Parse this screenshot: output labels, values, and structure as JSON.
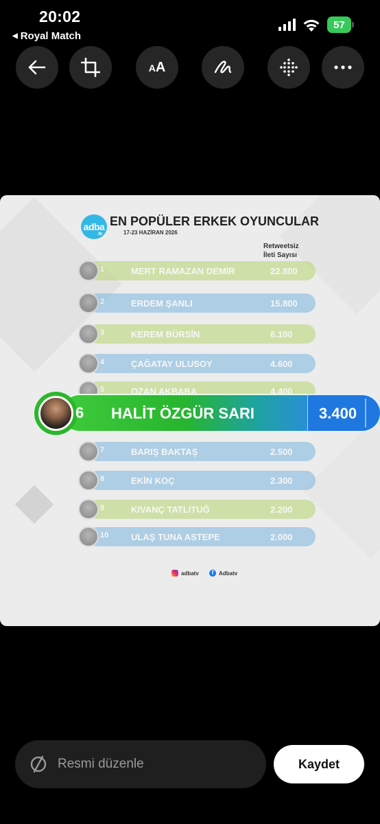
{
  "status_bar": {
    "time": "20:02",
    "back_app_label": "Royal Match",
    "battery_level": "57",
    "icons": [
      "signal-icon",
      "wifi-icon",
      "battery-icon"
    ]
  },
  "toolbar": {
    "buttons": [
      {
        "name": "back-button",
        "icon": "arrow-left-icon"
      },
      {
        "name": "crop-button",
        "icon": "crop-icon"
      },
      {
        "name": "text-button",
        "icon": "text-size-icon",
        "label": "AA"
      },
      {
        "name": "draw-button",
        "icon": "scribble-icon"
      },
      {
        "name": "mosaic-button",
        "icon": "dot-grid-icon"
      },
      {
        "name": "more-button",
        "icon": "ellipsis-icon"
      }
    ]
  },
  "photo": {
    "logo_text": "adba",
    "logo_sub": ".tv",
    "title": "EN POPÜLER ERKEK OYUNCULAR",
    "date": "17-23 HAZİRAN 2026",
    "column_header_line1": "Retweetsiz",
    "column_header_line2": "İleti Sayısı",
    "rows": [
      {
        "rank": "1",
        "name": "MERT RAMAZAN DEMİR",
        "value": "22.800",
        "color": "#b7d870"
      },
      {
        "rank": "2",
        "name": "ERDEM ŞANLI",
        "value": "15.800",
        "color": "#7bb7e0"
      },
      {
        "rank": "3",
        "name": "KEREM BÜRSİN",
        "value": "6.100",
        "color": "#b7d870"
      },
      {
        "rank": "4",
        "name": "ÇAĞATAY ULUSOY",
        "value": "4.600",
        "color": "#7bb7e0"
      },
      {
        "rank": "5",
        "name": "OZAN AKBABA",
        "value": "4.400",
        "color": "#b7d870"
      },
      {
        "rank": "7",
        "name": "BARIŞ BAKTAŞ",
        "value": "2.500",
        "color": "#7bb7e0"
      },
      {
        "rank": "8",
        "name": "EKİN KOÇ",
        "value": "2.300",
        "color": "#7bb7e0"
      },
      {
        "rank": "9",
        "name": "KIVANÇ TATLITUĞ",
        "value": "2.200",
        "color": "#b7d870"
      },
      {
        "rank": "10",
        "name": "ULAŞ TUNA ASTEPE",
        "value": "2.000",
        "color": "#7bb7e0"
      }
    ],
    "highlight": {
      "rank": "6",
      "name": "HALİT ÖZGÜR SARI",
      "value": "3.400"
    },
    "social": {
      "instagram": "adbatv",
      "facebook": "Adbatv"
    }
  },
  "bottom": {
    "edit_label": "Resmi düzenle",
    "save_label": "Kaydet"
  }
}
